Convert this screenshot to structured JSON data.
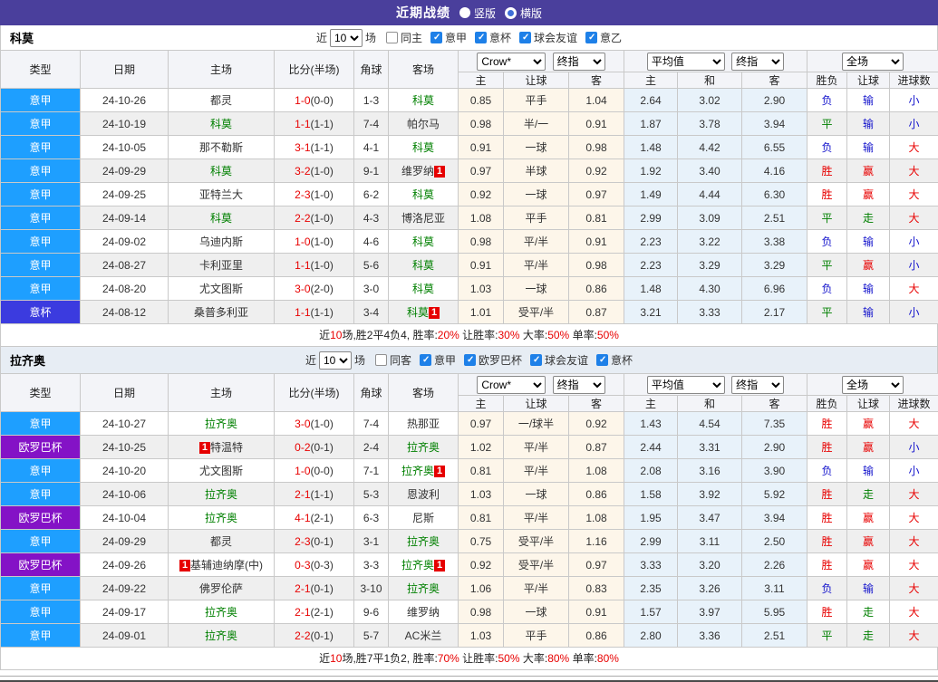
{
  "title_bar": {
    "title": "近期战绩",
    "view_options": [
      {
        "label": "竖版",
        "selected": true
      },
      {
        "label": "横版",
        "selected": false
      }
    ]
  },
  "colors": {
    "header_purple": "#4a3f9c",
    "serie_a_badge": "#1e9fff",
    "coppa_badge": "#3b3bdf",
    "europa_badge": "#8412c6",
    "team_green": "#008000",
    "win_red": "#e80000",
    "lose_blue": "#1414cc",
    "checkbox_blue": "#1e80e8"
  },
  "table_head": {
    "main": [
      "类型",
      "日期",
      "主场",
      "比分(半场)",
      "角球",
      "客场"
    ],
    "selects": {
      "odds_source": "Crow*",
      "odds_final": "终指",
      "avg": "平均值",
      "avg_final": "终指",
      "scope": "全场"
    },
    "sub": [
      "主",
      "让球",
      "客",
      "主",
      "和",
      "客",
      "胜负",
      "让球",
      "进球数"
    ]
  },
  "sections": [
    {
      "team": "科莫",
      "filter": {
        "near": "近",
        "count": "10",
        "games": "场",
        "same": "同主",
        "leagues": [
          "意甲",
          "意杯",
          "球会友谊",
          "意乙"
        ]
      },
      "rows": [
        {
          "league": "意甲",
          "date": "24-10-26",
          "home": {
            "name": "都灵"
          },
          "score_ft": "1-0",
          "score_ht": "(0-0)",
          "corners": "1-3",
          "away": {
            "name": "科莫",
            "self": true
          },
          "odds": [
            "0.85",
            "平手",
            "1.04",
            "2.64",
            "3.02",
            "2.90"
          ],
          "results": [
            "负",
            "输",
            "小"
          ]
        },
        {
          "league": "意甲",
          "date": "24-10-19",
          "home": {
            "name": "科莫",
            "self": true
          },
          "score_ft": "1-1",
          "score_ht": "(1-1)",
          "corners": "7-4",
          "away": {
            "name": "帕尔马"
          },
          "odds": [
            "0.98",
            "半/一",
            "0.91",
            "1.87",
            "3.78",
            "3.94"
          ],
          "results": [
            "平",
            "输",
            "小"
          ]
        },
        {
          "league": "意甲",
          "date": "24-10-05",
          "home": {
            "name": "那不勒斯"
          },
          "score_ft": "3-1",
          "score_ht": "(1-1)",
          "corners": "4-1",
          "away": {
            "name": "科莫",
            "self": true
          },
          "odds": [
            "0.91",
            "一球",
            "0.98",
            "1.48",
            "4.42",
            "6.55"
          ],
          "results": [
            "负",
            "输",
            "大"
          ]
        },
        {
          "league": "意甲",
          "date": "24-09-29",
          "home": {
            "name": "科莫",
            "self": true
          },
          "score_ft": "3-2",
          "score_ht": "(1-0)",
          "corners": "9-1",
          "away": {
            "name": "维罗纳",
            "badge": "1",
            "badge_pos": "after"
          },
          "odds": [
            "0.97",
            "半球",
            "0.92",
            "1.92",
            "3.40",
            "4.16"
          ],
          "results": [
            "胜",
            "赢",
            "大"
          ]
        },
        {
          "league": "意甲",
          "date": "24-09-25",
          "home": {
            "name": "亚特兰大"
          },
          "score_ft": "2-3",
          "score_ht": "(1-0)",
          "corners": "6-2",
          "away": {
            "name": "科莫",
            "self": true
          },
          "odds": [
            "0.92",
            "一球",
            "0.97",
            "1.49",
            "4.44",
            "6.30"
          ],
          "results": [
            "胜",
            "赢",
            "大"
          ]
        },
        {
          "league": "意甲",
          "date": "24-09-14",
          "home": {
            "name": "科莫",
            "self": true
          },
          "score_ft": "2-2",
          "score_ht": "(1-0)",
          "corners": "4-3",
          "away": {
            "name": "博洛尼亚"
          },
          "odds": [
            "1.08",
            "平手",
            "0.81",
            "2.99",
            "3.09",
            "2.51"
          ],
          "results": [
            "平",
            "走",
            "大"
          ]
        },
        {
          "league": "意甲",
          "date": "24-09-02",
          "home": {
            "name": "乌迪内斯"
          },
          "score_ft": "1-0",
          "score_ht": "(1-0)",
          "corners": "4-6",
          "away": {
            "name": "科莫",
            "self": true
          },
          "odds": [
            "0.98",
            "平/半",
            "0.91",
            "2.23",
            "3.22",
            "3.38"
          ],
          "results": [
            "负",
            "输",
            "小"
          ]
        },
        {
          "league": "意甲",
          "date": "24-08-27",
          "home": {
            "name": "卡利亚里"
          },
          "score_ft": "1-1",
          "score_ht": "(1-0)",
          "corners": "5-6",
          "away": {
            "name": "科莫",
            "self": true
          },
          "odds": [
            "0.91",
            "平/半",
            "0.98",
            "2.23",
            "3.29",
            "3.29"
          ],
          "results": [
            "平",
            "赢",
            "小"
          ]
        },
        {
          "league": "意甲",
          "date": "24-08-20",
          "home": {
            "name": "尤文图斯"
          },
          "score_ft": "3-0",
          "score_ht": "(2-0)",
          "corners": "3-0",
          "away": {
            "name": "科莫",
            "self": true
          },
          "odds": [
            "1.03",
            "一球",
            "0.86",
            "1.48",
            "4.30",
            "6.96"
          ],
          "results": [
            "负",
            "输",
            "大"
          ]
        },
        {
          "league": "意杯",
          "date": "24-08-12",
          "home": {
            "name": "桑普多利亚"
          },
          "score_ft": "1-1",
          "score_ht": "(1-1)",
          "corners": "3-4",
          "away": {
            "name": "科莫",
            "self": true,
            "badge": "1",
            "badge_pos": "after"
          },
          "odds": [
            "1.01",
            "受平/半",
            "0.87",
            "3.21",
            "3.33",
            "2.17"
          ],
          "results": [
            "平",
            "输",
            "小"
          ]
        }
      ],
      "summary": [
        {
          "t": "近"
        },
        {
          "t": "10",
          "red": true
        },
        {
          "t": "场,胜2平4负4, 胜率:"
        },
        {
          "t": "20%",
          "red": true
        },
        {
          "t": " 让胜率:"
        },
        {
          "t": "30%",
          "red": true
        },
        {
          "t": " 大率:"
        },
        {
          "t": "50%",
          "red": true
        },
        {
          "t": " 单率:"
        },
        {
          "t": "50%",
          "red": true
        }
      ]
    },
    {
      "team": "拉齐奥",
      "filter": {
        "near": "近",
        "count": "10",
        "games": "场",
        "same": "同客",
        "leagues": [
          "意甲",
          "欧罗巴杯",
          "球会友谊",
          "意杯"
        ]
      },
      "rows": [
        {
          "league": "意甲",
          "date": "24-10-27",
          "home": {
            "name": "拉齐奥",
            "self": true
          },
          "score_ft": "3-0",
          "score_ht": "(1-0)",
          "corners": "7-4",
          "away": {
            "name": "热那亚"
          },
          "odds": [
            "0.97",
            "一/球半",
            "0.92",
            "1.43",
            "4.54",
            "7.35"
          ],
          "results": [
            "胜",
            "赢",
            "大"
          ]
        },
        {
          "league": "欧罗巴杯",
          "date": "24-10-25",
          "home": {
            "name": "特温特",
            "badge": "1",
            "badge_pos": "before"
          },
          "score_ft": "0-2",
          "score_ht": "(0-1)",
          "corners": "2-4",
          "away": {
            "name": "拉齐奥",
            "self": true
          },
          "odds": [
            "1.02",
            "平/半",
            "0.87",
            "2.44",
            "3.31",
            "2.90"
          ],
          "results": [
            "胜",
            "赢",
            "小"
          ]
        },
        {
          "league": "意甲",
          "date": "24-10-20",
          "home": {
            "name": "尤文图斯"
          },
          "score_ft": "1-0",
          "score_ht": "(0-0)",
          "corners": "7-1",
          "away": {
            "name": "拉齐奥",
            "self": true,
            "badge": "1",
            "badge_pos": "after"
          },
          "odds": [
            "0.81",
            "平/半",
            "1.08",
            "2.08",
            "3.16",
            "3.90"
          ],
          "results": [
            "负",
            "输",
            "小"
          ]
        },
        {
          "league": "意甲",
          "date": "24-10-06",
          "home": {
            "name": "拉齐奥",
            "self": true
          },
          "score_ft": "2-1",
          "score_ht": "(1-1)",
          "corners": "5-3",
          "away": {
            "name": "恩波利"
          },
          "odds": [
            "1.03",
            "一球",
            "0.86",
            "1.58",
            "3.92",
            "5.92"
          ],
          "results": [
            "胜",
            "走",
            "大"
          ]
        },
        {
          "league": "欧罗巴杯",
          "date": "24-10-04",
          "home": {
            "name": "拉齐奥",
            "self": true
          },
          "score_ft": "4-1",
          "score_ht": "(2-1)",
          "corners": "6-3",
          "away": {
            "name": "尼斯"
          },
          "odds": [
            "0.81",
            "平/半",
            "1.08",
            "1.95",
            "3.47",
            "3.94"
          ],
          "results": [
            "胜",
            "赢",
            "大"
          ]
        },
        {
          "league": "意甲",
          "date": "24-09-29",
          "home": {
            "name": "都灵"
          },
          "score_ft": "2-3",
          "score_ht": "(0-1)",
          "corners": "3-1",
          "away": {
            "name": "拉齐奥",
            "self": true
          },
          "odds": [
            "0.75",
            "受平/半",
            "1.16",
            "2.99",
            "3.11",
            "2.50"
          ],
          "results": [
            "胜",
            "赢",
            "大"
          ]
        },
        {
          "league": "欧罗巴杯",
          "date": "24-09-26",
          "home": {
            "name": "基辅迪纳摩(中)",
            "badge": "1",
            "badge_pos": "before"
          },
          "score_ft": "0-3",
          "score_ht": "(0-3)",
          "corners": "3-3",
          "away": {
            "name": "拉齐奥",
            "self": true,
            "badge": "1",
            "badge_pos": "after"
          },
          "odds": [
            "0.92",
            "受平/半",
            "0.97",
            "3.33",
            "3.20",
            "2.26"
          ],
          "results": [
            "胜",
            "赢",
            "大"
          ]
        },
        {
          "league": "意甲",
          "date": "24-09-22",
          "home": {
            "name": "佛罗伦萨"
          },
          "score_ft": "2-1",
          "score_ht": "(0-1)",
          "corners": "3-10",
          "away": {
            "name": "拉齐奥",
            "self": true
          },
          "odds": [
            "1.06",
            "平/半",
            "0.83",
            "2.35",
            "3.26",
            "3.11"
          ],
          "results": [
            "负",
            "输",
            "大"
          ]
        },
        {
          "league": "意甲",
          "date": "24-09-17",
          "home": {
            "name": "拉齐奥",
            "self": true
          },
          "score_ft": "2-1",
          "score_ht": "(2-1)",
          "corners": "9-6",
          "away": {
            "name": "维罗纳"
          },
          "odds": [
            "0.98",
            "一球",
            "0.91",
            "1.57",
            "3.97",
            "5.95"
          ],
          "results": [
            "胜",
            "走",
            "大"
          ]
        },
        {
          "league": "意甲",
          "date": "24-09-01",
          "home": {
            "name": "拉齐奥",
            "self": true
          },
          "score_ft": "2-2",
          "score_ht": "(0-1)",
          "corners": "5-7",
          "away": {
            "name": "AC米兰"
          },
          "odds": [
            "1.03",
            "平手",
            "0.86",
            "2.80",
            "3.36",
            "2.51"
          ],
          "results": [
            "平",
            "走",
            "大"
          ]
        }
      ],
      "summary": [
        {
          "t": "近"
        },
        {
          "t": "10",
          "red": true
        },
        {
          "t": "场,胜7平1负2, 胜率:"
        },
        {
          "t": "70%",
          "red": true
        },
        {
          "t": " 让胜率:"
        },
        {
          "t": "50%",
          "red": true
        },
        {
          "t": " 大率:"
        },
        {
          "t": "80%",
          "red": true
        },
        {
          "t": " 单率:"
        },
        {
          "t": "80%",
          "red": true
        }
      ]
    }
  ]
}
